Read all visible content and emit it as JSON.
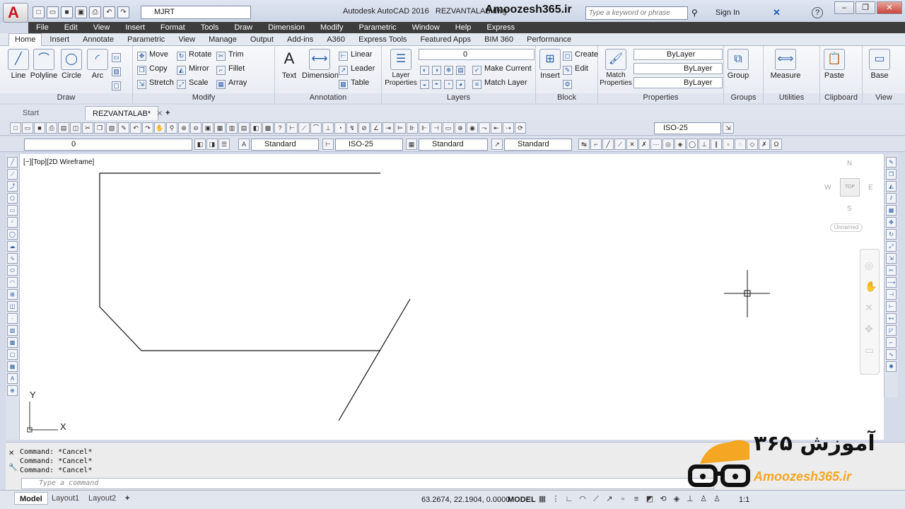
{
  "window": {
    "app_name": "Autodesk AutoCAD 2016",
    "file_name": "REZVANTALAB.dwg",
    "brand": "Amoozesh365.ir",
    "workspace": "MJRT",
    "search_placeholder": "Type a keyword or phrase",
    "sign_in": "Sign In",
    "help": "?"
  },
  "menu": [
    "File",
    "Edit",
    "View",
    "Insert",
    "Format",
    "Tools",
    "Draw",
    "Dimension",
    "Modify",
    "Parametric",
    "Window",
    "Help",
    "Express"
  ],
  "ribbon_tabs": [
    "Home",
    "Insert",
    "Annotate",
    "Parametric",
    "View",
    "Manage",
    "Output",
    "Add-ins",
    "A360",
    "Express Tools",
    "Featured Apps",
    "BIM 360",
    "Performance"
  ],
  "ribbon": {
    "draw": {
      "title": "Draw",
      "line": "Line",
      "polyline": "Polyline",
      "circle": "Circle",
      "arc": "Arc"
    },
    "modify": {
      "title": "Modify",
      "move": "Move",
      "rotate": "Rotate",
      "trim": "Trim",
      "copy": "Copy",
      "mirror": "Mirror",
      "fillet": "Fillet",
      "stretch": "Stretch",
      "scale": "Scale",
      "array": "Array"
    },
    "annotation": {
      "title": "Annotation",
      "text": "Text",
      "dimension": "Dimension",
      "linear": "Linear",
      "leader": "Leader",
      "table": "Table"
    },
    "layers": {
      "title": "Layers",
      "layer_properties": "Layer Properties",
      "current_layer": "0",
      "make_current": "Make Current",
      "match_layer": "Match Layer"
    },
    "block": {
      "title": "Block",
      "insert": "Insert",
      "create": "Create",
      "edit": "Edit"
    },
    "properties": {
      "title": "Properties",
      "match_properties": "Match Properties",
      "color": "ByLayer",
      "linetype": "ByLayer",
      "lineweight": "ByLayer"
    },
    "groups": {
      "title": "Groups",
      "group": "Group"
    },
    "utilities": {
      "title": "Utilities",
      "measure": "Measure"
    },
    "clipboard": {
      "title": "Clipboard",
      "paste": "Paste"
    },
    "view": {
      "title": "View",
      "base": "Base"
    }
  },
  "doc_tabs": {
    "start": "Start",
    "current": "REZVANTALAB*"
  },
  "toolbars": {
    "dimstyle": "ISO-25",
    "layer": "0",
    "text_style": "Standard",
    "dim_style2": "ISO-25",
    "table_style": "Standard",
    "mleader_style": "Standard"
  },
  "viewport": {
    "label": "[−][Top][2D Wireframe]",
    "cube_n": "N",
    "cube_s": "S",
    "cube_e": "E",
    "cube_w": "W",
    "cube_top": "TOP",
    "ucs_name": "Unnamed",
    "ucs_x": "X",
    "ucs_y": "Y"
  },
  "command": {
    "history": [
      "Command: *Cancel*",
      "Command: *Cancel*",
      "Command: *Cancel*"
    ],
    "placeholder": "Type a command"
  },
  "status": {
    "layouts": [
      "Model",
      "Layout1",
      "Layout2"
    ],
    "coords": "63.2674, 22.1904, 0.0000",
    "space": "MODEL",
    "scale": "1:1"
  },
  "logo": {
    "persian": "آموزش ۳۶۵",
    "latin": "Amoozesh365.ir"
  },
  "colors": {
    "autocad_red": "#c8171e",
    "logo_orange": "#f5a623",
    "menubar": "#3d3d3d"
  }
}
